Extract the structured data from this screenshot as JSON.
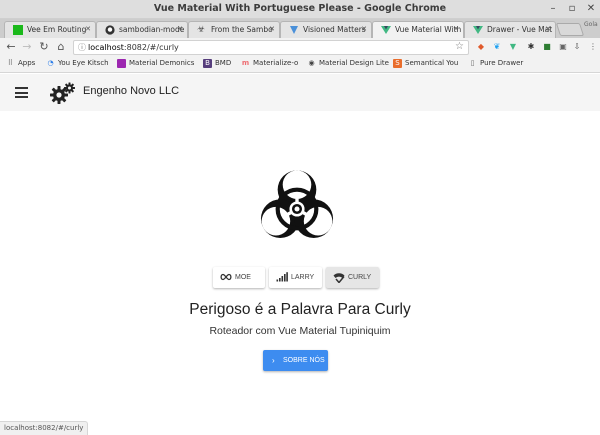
{
  "window": {
    "title": "Vue Material With Portuguese Please - Google Chrome"
  },
  "tabs": [
    {
      "label": "Vee Em Routing",
      "active": false,
      "fav_color": "#1bb91b"
    },
    {
      "label": "sambodian-mode",
      "active": false,
      "fav_color": "#333333"
    },
    {
      "label": "From the Sambo",
      "active": false,
      "fav_color": "#444444"
    },
    {
      "label": "Visioned Matters",
      "active": false,
      "fav_color": "#4a90d9"
    },
    {
      "label": "Vue Material With",
      "active": true,
      "fav_color": "#41b883"
    },
    {
      "label": "Drawer - Vue Mat",
      "active": false,
      "fav_color": "#41b883"
    }
  ],
  "profile_label": "Gola",
  "address": {
    "host": "localhost",
    "path": ":8082/#/curly"
  },
  "bookmarks": [
    {
      "label": "Apps",
      "color": "#888888"
    },
    {
      "label": "You Eye Kitsch",
      "color": "#2b7de9"
    },
    {
      "label": "Material Demonics",
      "color": "#9c27b0"
    },
    {
      "label": "BMD",
      "color": "#563d7c"
    },
    {
      "label": "Materialize-o",
      "color": "#ee6e73"
    },
    {
      "label": "Material Design Lite",
      "color": "#444444"
    },
    {
      "label": "Semantical You",
      "color": "#e96d2c"
    },
    {
      "label": "Pure Drawer",
      "color": "#666666"
    }
  ],
  "app": {
    "title": "Engenho Novo LLC",
    "toggles": [
      {
        "label": "Moe",
        "icon": "infinity-icon",
        "active": false
      },
      {
        "label": "Larry",
        "icon": "signal-bars-icon",
        "active": false
      },
      {
        "label": "Curly",
        "icon": "network-check-icon",
        "active": true
      }
    ],
    "headline": "Perigoso é a Palavra Para Curly",
    "subheadline": "Roteador com Vue Material Tupiniquim",
    "about_button": "Sobre Nós",
    "accent_color": "#3d8cf0"
  },
  "status_url": "localhost:8082/#/curly"
}
